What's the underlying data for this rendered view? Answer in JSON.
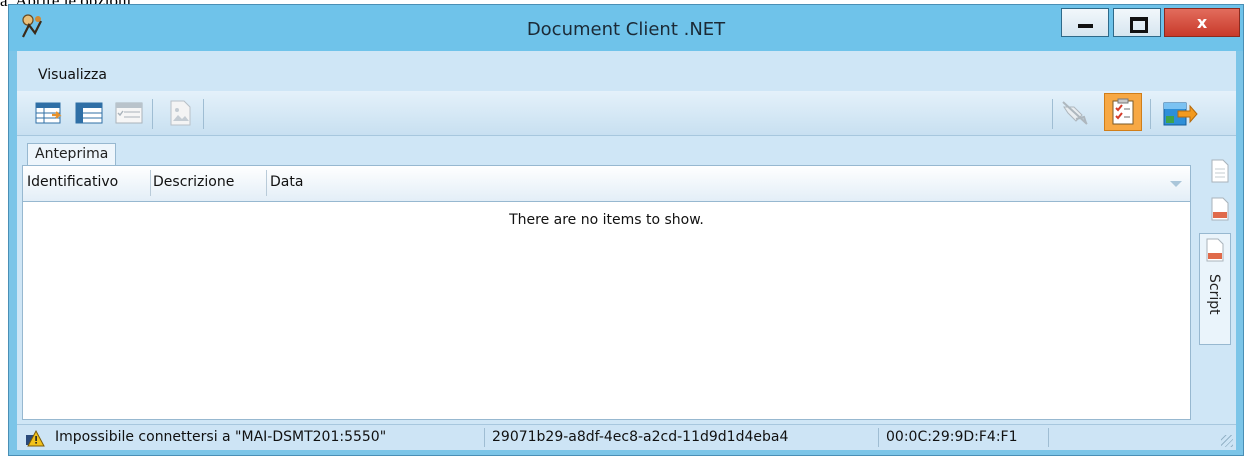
{
  "doc_caption": "a.   Aprire le opzioni.",
  "window": {
    "title": "Document Client .NET",
    "close_label": "x"
  },
  "menu": {
    "items": [
      "Visualizza"
    ]
  },
  "toolbar": {
    "icons": [
      "table-refresh-icon",
      "table-icon",
      "list-check-icon",
      "document-image-icon",
      "disconnected-plug-icon",
      "checklist-icon",
      "export-icon"
    ]
  },
  "tabs": {
    "preview": "Anteprima"
  },
  "grid": {
    "columns": [
      "Identificativo",
      "Descrizione",
      "Data"
    ],
    "empty_message": "There are no items to show."
  },
  "side_panel": {
    "tab_label": "Script"
  },
  "status": {
    "message": "Impossibile connettersi a \"MAI-DSMT201:5550\"",
    "guid": "29071b29-a8df-4ec8-a2cd-11d9d1d4eba4",
    "mac": "00:0C:29:9D:F4:F1"
  },
  "colors": {
    "titlebar": "#6fc3ea",
    "client": "#cfe6f6",
    "active_toolbar": "#f7a844",
    "close_button": "#c83a2b"
  }
}
